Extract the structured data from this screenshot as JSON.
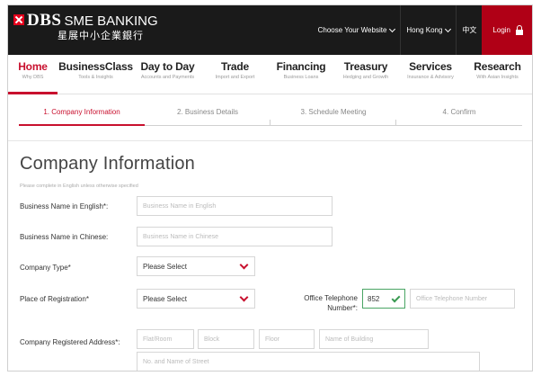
{
  "header": {
    "logo_text": "DBS",
    "logo_sub": "SME BANKING",
    "logo_chinese": "星展中小企業銀行",
    "choose_website": "Choose Your Website",
    "region": "Hong Kong",
    "language": "中文",
    "login": "Login"
  },
  "nav": [
    {
      "title": "Home",
      "sub": "Why DBS"
    },
    {
      "title": "BusinessClass",
      "sub": "Tools & Insights"
    },
    {
      "title": "Day to Day",
      "sub": "Accounts and Payments"
    },
    {
      "title": "Trade",
      "sub": "Import and Export"
    },
    {
      "title": "Financing",
      "sub": "Business Loans"
    },
    {
      "title": "Treasury",
      "sub": "Hedging and Growth"
    },
    {
      "title": "Services",
      "sub": "Insurance & Advisory"
    },
    {
      "title": "Research",
      "sub": "With Asian Insights"
    }
  ],
  "steps": [
    "1. Company Information",
    "2. Business Details",
    "3. Schedule Meeting",
    "4. Confirm"
  ],
  "form": {
    "title": "Company Information",
    "note": "Please complete in English unless otherwise specified",
    "business_name_en_label": "Business Name in English*:",
    "business_name_en_placeholder": "Business Name in English",
    "business_name_cn_label": "Business Name in Chinese:",
    "business_name_cn_placeholder": "Business Name in Chinese",
    "company_type_label": "Company Type*",
    "company_type_value": "Please Select",
    "place_reg_label": "Place of Registration*",
    "place_reg_value": "Please Select",
    "office_tel_label_1": "Office Telephone",
    "office_tel_label_2": "Number*:",
    "country_code": "852",
    "office_tel_placeholder": "Office Telephone Number",
    "address_label": "Company Registered Address*:",
    "flat_room_placeholder": "Flat/Room",
    "block_placeholder": "Block",
    "floor_placeholder": "Floor",
    "building_placeholder": "Name of Building",
    "street_placeholder": "No. and Name of Street"
  }
}
